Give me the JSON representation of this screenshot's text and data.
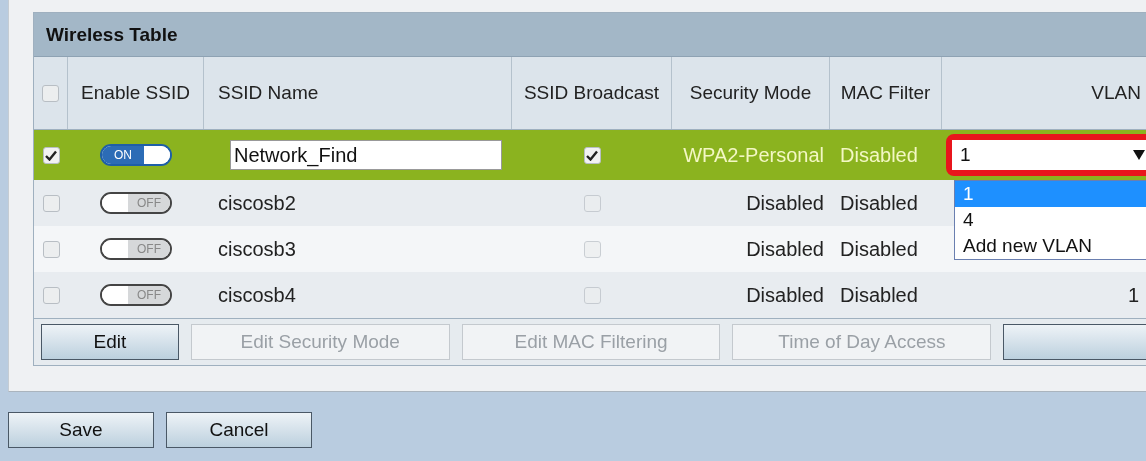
{
  "panel": {
    "title": "Wireless Table"
  },
  "table": {
    "header_checkbox": {
      "checked": false
    },
    "columns": [
      "Enable SSID",
      "SSID Name",
      "SSID Broadcast",
      "Security Mode",
      "MAC Filter",
      "VLAN"
    ],
    "rows": [
      {
        "selected": true,
        "checked": true,
        "enabled": true,
        "enable_label": "ON",
        "ssid_name": "Network_Find",
        "editing": true,
        "broadcast": true,
        "security_mode": "WPA2-Personal",
        "mac_filter": "Disabled",
        "vlan_select": {
          "value": "1",
          "open": true,
          "highlighted": true,
          "options": [
            {
              "label": "1",
              "selected": true
            },
            {
              "label": "4",
              "selected": false
            },
            {
              "label": "Add new VLAN",
              "selected": false
            }
          ]
        }
      },
      {
        "selected": false,
        "checked": false,
        "enabled": false,
        "enable_label": "OFF",
        "ssid_name": "ciscosb2",
        "editing": false,
        "broadcast": false,
        "security_mode": "Disabled",
        "mac_filter": "Disabled"
      },
      {
        "selected": false,
        "checked": false,
        "enabled": false,
        "enable_label": "OFF",
        "ssid_name": "ciscosb3",
        "editing": false,
        "broadcast": false,
        "security_mode": "Disabled",
        "mac_filter": "Disabled"
      },
      {
        "selected": false,
        "checked": false,
        "enabled": false,
        "enable_label": "OFF",
        "ssid_name": "ciscosb4",
        "editing": false,
        "broadcast": false,
        "security_mode": "Disabled",
        "mac_filter": "Disabled",
        "vlan": "1"
      }
    ],
    "buttons": [
      {
        "label": "Edit",
        "disabled": false
      },
      {
        "label": "Edit Security Mode",
        "disabled": true
      },
      {
        "label": "Edit MAC Filtering",
        "disabled": true
      },
      {
        "label": "Time of Day Access",
        "disabled": true
      },
      {
        "disabled": false
      }
    ]
  },
  "footer_buttons": [
    "Save",
    "Cancel"
  ]
}
